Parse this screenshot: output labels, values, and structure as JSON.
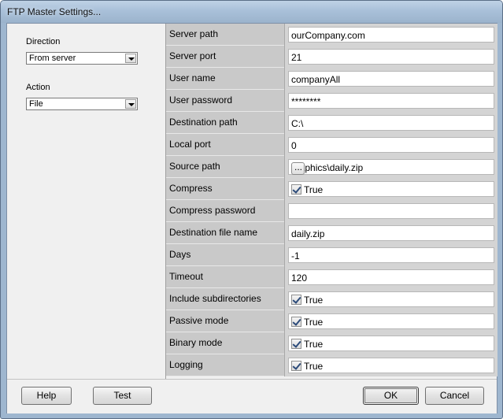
{
  "window": {
    "title": "FTP Master Settings..."
  },
  "left": {
    "direction": {
      "label": "Direction",
      "value": "From server"
    },
    "action": {
      "label": "Action",
      "value": "File"
    }
  },
  "properties": [
    {
      "name": "Server path",
      "value": "ourCompany.com",
      "type": "text"
    },
    {
      "name": "Server port",
      "value": "21",
      "type": "text"
    },
    {
      "name": "User name",
      "value": "companyAll",
      "type": "text"
    },
    {
      "name": "User password",
      "value": "********",
      "type": "text"
    },
    {
      "name": "Destination path",
      "value": "C:\\",
      "type": "text"
    },
    {
      "name": "Local port",
      "value": "0",
      "type": "text"
    },
    {
      "name": "Source path",
      "value": "graphics\\daily.zip",
      "type": "browse",
      "button_label": "..."
    },
    {
      "name": "Compress",
      "value": "True",
      "type": "checkbox",
      "checked": true
    },
    {
      "name": "Compress password",
      "value": "",
      "type": "text"
    },
    {
      "name": "Destination file name",
      "value": "daily.zip",
      "type": "text"
    },
    {
      "name": "Days",
      "value": "-1",
      "type": "text"
    },
    {
      "name": "Timeout",
      "value": "120",
      "type": "text"
    },
    {
      "name": "Include subdirectories",
      "value": "True",
      "type": "checkbox",
      "checked": true
    },
    {
      "name": "Passive mode",
      "value": "True",
      "type": "checkbox",
      "checked": true
    },
    {
      "name": "Binary mode",
      "value": "True",
      "type": "checkbox",
      "checked": true
    },
    {
      "name": "Logging",
      "value": "True",
      "type": "checkbox",
      "checked": true
    }
  ],
  "footer": {
    "help_label": "Help",
    "test_label": "Test",
    "ok_label": "OK",
    "cancel_label": "Cancel"
  }
}
